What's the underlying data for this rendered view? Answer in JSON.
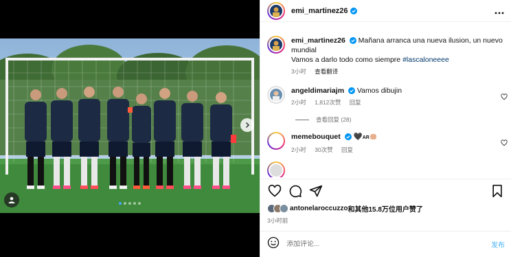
{
  "post": {
    "username": "emi_martinez26",
    "caption_line1": "Mañana arranca una nueva ilusion, un nuevo mundial",
    "caption_line2": "Vamos a darlo todo como siempre ",
    "hashtag": "#lascaloneeee",
    "caption_time": "3小时",
    "translate": "查看翻译"
  },
  "comments": [
    {
      "username": "angeldimariajm",
      "text": "Vamos dibujin",
      "time": "2小时",
      "likes": "1,812次赞",
      "reply": "回复"
    },
    {
      "username": "memebouquet",
      "text": "🖤",
      "badge": "AR",
      "time": "2小时",
      "likes": "30次赞",
      "reply": "回复"
    }
  ],
  "view_replies": "查看回复 (28)",
  "likes_line": {
    "first_user": "antonelaroccuzzo",
    "rest": "和其他15.8万位用户赞了"
  },
  "post_time": "3小时前",
  "comment_box": {
    "placeholder": "添加评论...",
    "post_label": "发布"
  },
  "carousel": {
    "total": 5,
    "active": 0
  },
  "icons": [
    "more-horizontal-icon",
    "heart-icon",
    "comment-icon",
    "share-icon",
    "bookmark-icon",
    "emoji-icon",
    "chevron-right-icon",
    "user-tag-icon",
    "verified-icon"
  ]
}
